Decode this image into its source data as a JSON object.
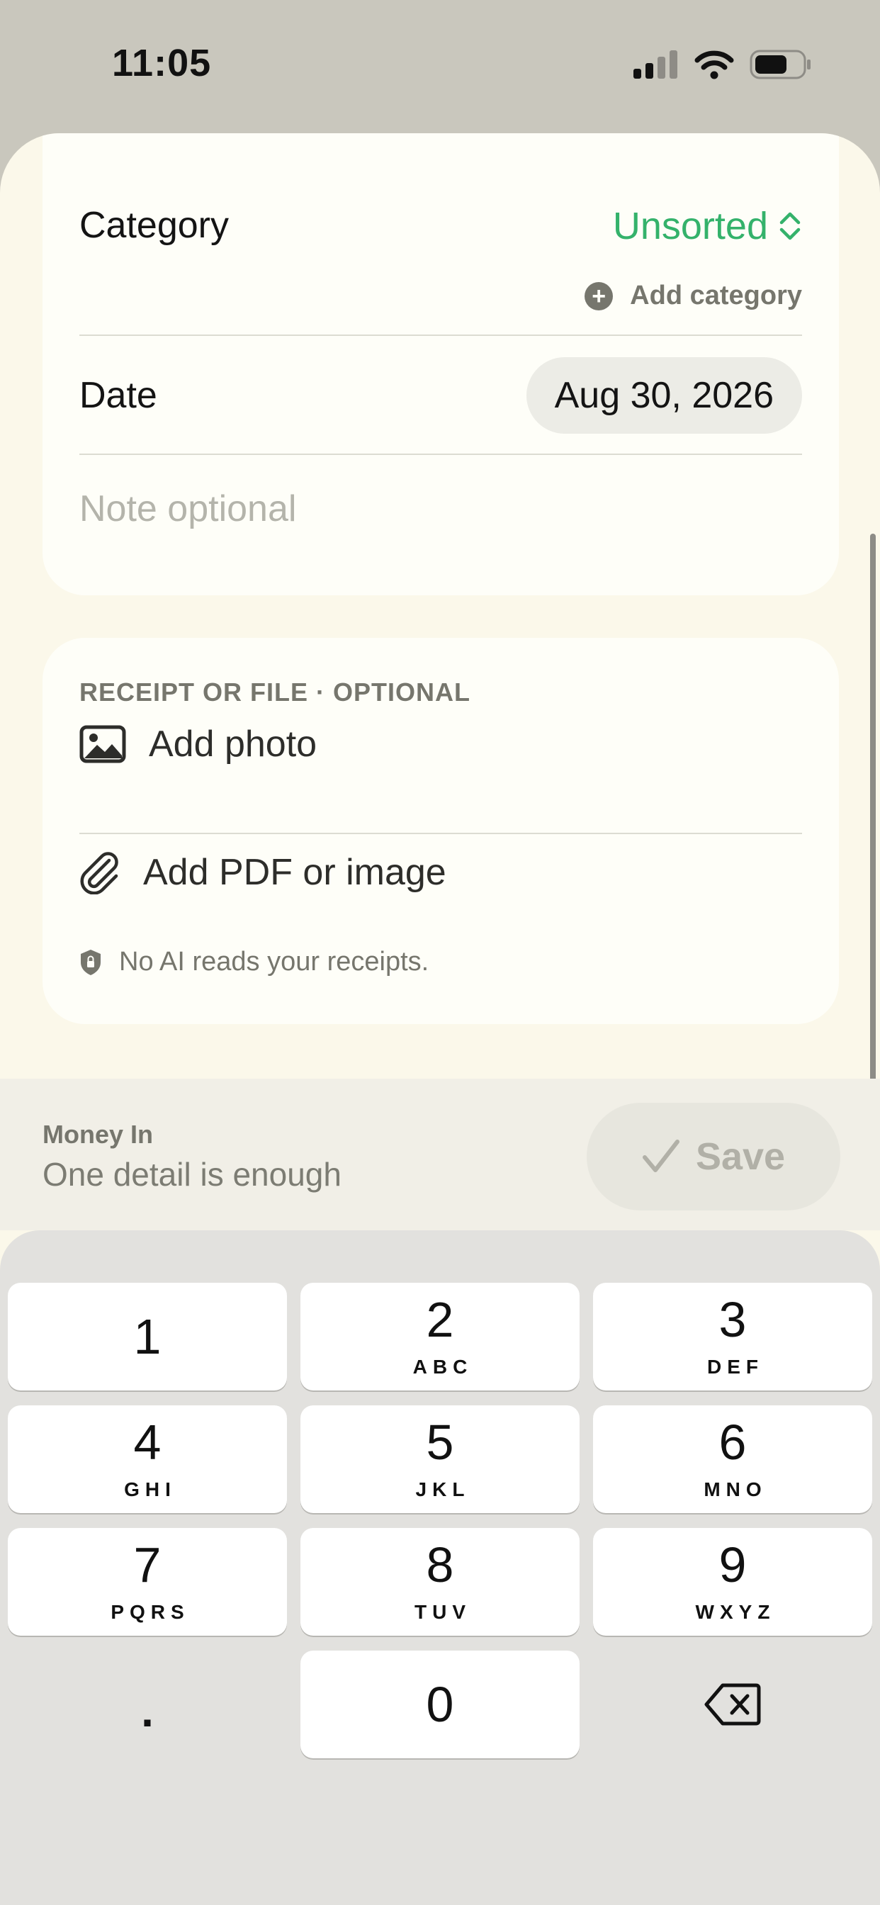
{
  "status_bar": {
    "time": "11:05"
  },
  "form": {
    "category_label": "Category",
    "category_value": "Unsorted",
    "add_category_label": "Add category",
    "date_label": "Date",
    "date_value": "Aug 30, 2026",
    "note_placeholder": "Note  optional"
  },
  "attachments": {
    "section_title": "RECEIPT OR FILE · OPTIONAL",
    "add_photo_label": "Add photo",
    "add_pdf_label": "Add PDF or image",
    "privacy_note": "No AI reads your receipts."
  },
  "bottom_bar": {
    "mode_label": "Money In",
    "hint": "One detail is enough",
    "save_label": "Save"
  },
  "keypad": {
    "keys": [
      {
        "digit": "1",
        "letters": ""
      },
      {
        "digit": "2",
        "letters": "ABC"
      },
      {
        "digit": "3",
        "letters": "DEF"
      },
      {
        "digit": "4",
        "letters": "GHI"
      },
      {
        "digit": "5",
        "letters": "JKL"
      },
      {
        "digit": "6",
        "letters": "MNO"
      },
      {
        "digit": "7",
        "letters": "PQRS"
      },
      {
        "digit": "8",
        "letters": "TUV"
      },
      {
        "digit": "9",
        "letters": "WXYZ"
      },
      {
        "digit": "0",
        "letters": ""
      }
    ],
    "decimal_label": "."
  },
  "colors": {
    "accent_green": "#34b26b",
    "sheet_background": "#fbf8ea",
    "muted_text": "#76766d"
  },
  "icons": [
    "cellular-signal-icon",
    "wifi-icon",
    "battery-icon",
    "updown-chevron-icon",
    "plus-circle-icon",
    "photo-icon",
    "paperclip-icon",
    "shield-lock-icon",
    "checkmark-icon",
    "backspace-icon"
  ]
}
